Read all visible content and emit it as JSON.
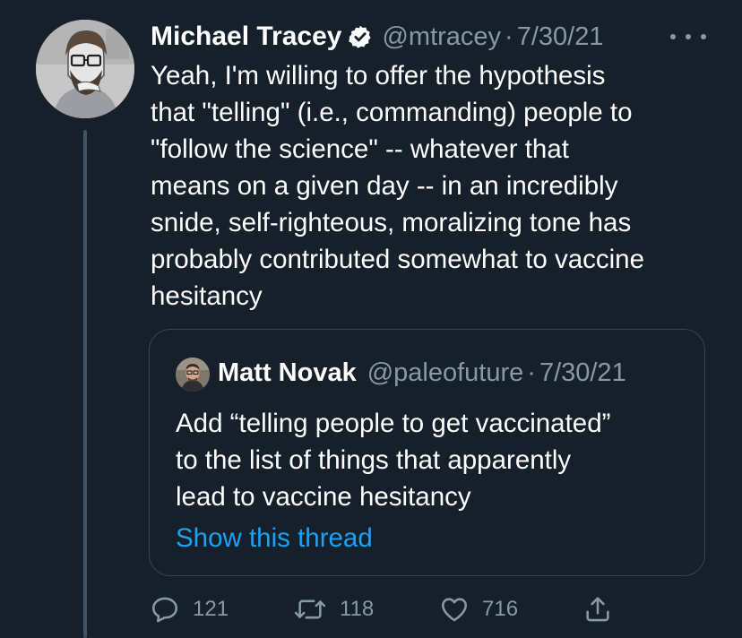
{
  "tweet": {
    "author": {
      "display_name": "Michael Tracey",
      "handle": "@mtracey",
      "verified": true,
      "avatar": "bearded-man-with-glasses-drawing"
    },
    "separator": "·",
    "date": "7/30/21",
    "more_icon": "more-horizontal-icon",
    "text_lines": [
      "Yeah, I'm willing to offer the hypothesis",
      "that \"telling\" (i.e., commanding) people to",
      "\"follow the science\" -- whatever that",
      "means on a given day -- in an incredibly",
      "snide, self-righteous, moralizing tone has",
      "probably contributed somewhat to vaccine",
      "hesitancy"
    ]
  },
  "quote": {
    "author": {
      "display_name": "Matt Novak",
      "handle": "@paleofuture",
      "avatar": "man-with-glasses-photo"
    },
    "separator": "·",
    "date": "7/30/21",
    "text_lines": [
      "Add “telling people to get vaccinated”",
      "to the list of things that apparently",
      "lead to vaccine hesitancy"
    ],
    "show_thread": "Show this thread"
  },
  "actions": {
    "reply": {
      "icon": "reply-icon",
      "count": "121"
    },
    "retweet": {
      "icon": "retweet-icon",
      "count": "118"
    },
    "like": {
      "icon": "heart-icon",
      "count": "716"
    },
    "share": {
      "icon": "share-icon"
    }
  },
  "colors": {
    "background": "#15202b",
    "text_primary": "#ffffff",
    "text_secondary": "#8899a6",
    "link": "#1da1f2",
    "border": "#38444d",
    "thread_line": "#3d5466"
  }
}
